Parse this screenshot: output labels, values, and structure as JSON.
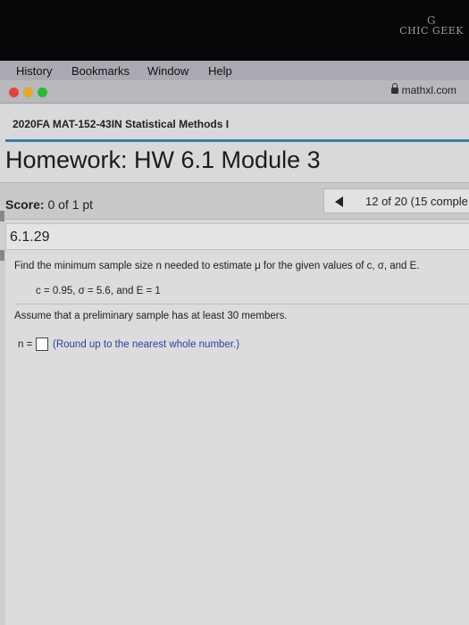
{
  "brand": {
    "text": "CHIC GEEK",
    "logo": "G"
  },
  "menubar": {
    "items": [
      "History",
      "Bookmarks",
      "Window",
      "Help"
    ]
  },
  "browser": {
    "url": "mathxl.com",
    "traffic_lights": {
      "close": "#e0443e",
      "minimize": "#e2a829",
      "zoom": "#2fb73a"
    }
  },
  "course": {
    "title": "2020FA MAT-152-43IN Statistical Methods I"
  },
  "homework": {
    "title": "Homework: HW 6.1 Module 3"
  },
  "score": {
    "label": "Score:",
    "value": "0 of 1 pt"
  },
  "progress": {
    "text": "12 of 20 (15 comple"
  },
  "question": {
    "number": "6.1.29",
    "prompt": "Find the minimum sample size n needed to estimate μ for the given values of c, σ, and E.",
    "given": "c = 0.95, σ = 5.6, and E = 1",
    "assumption": "Assume that a preliminary sample has at least 30 members.",
    "answer_label": "n =",
    "answer_value": "",
    "hint": "(Round up to the nearest whole number.)"
  },
  "colors": {
    "accent_rule": "#3a7ca8",
    "hint_text": "#2b3f9c"
  }
}
